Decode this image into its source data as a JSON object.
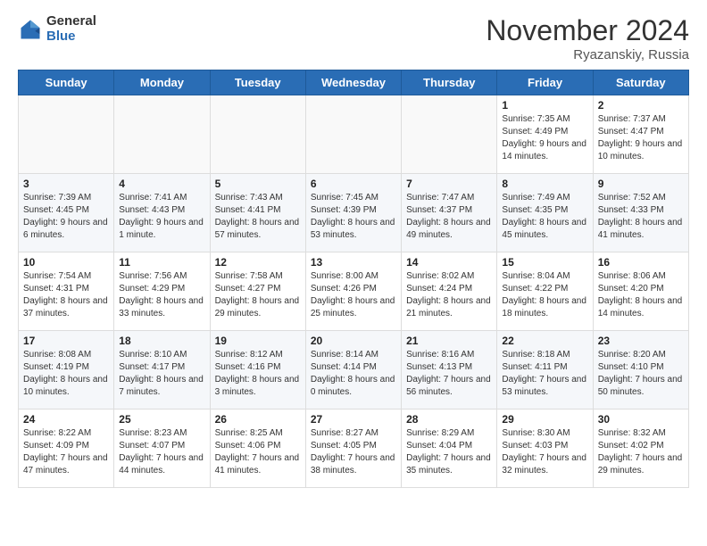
{
  "header": {
    "logo_general": "General",
    "logo_blue": "Blue",
    "month_title": "November 2024",
    "location": "Ryazanskiy, Russia"
  },
  "days_of_week": [
    "Sunday",
    "Monday",
    "Tuesday",
    "Wednesday",
    "Thursday",
    "Friday",
    "Saturday"
  ],
  "weeks": [
    [
      {
        "day": "",
        "info": ""
      },
      {
        "day": "",
        "info": ""
      },
      {
        "day": "",
        "info": ""
      },
      {
        "day": "",
        "info": ""
      },
      {
        "day": "",
        "info": ""
      },
      {
        "day": "1",
        "info": "Sunrise: 7:35 AM\nSunset: 4:49 PM\nDaylight: 9 hours and 14 minutes."
      },
      {
        "day": "2",
        "info": "Sunrise: 7:37 AM\nSunset: 4:47 PM\nDaylight: 9 hours and 10 minutes."
      }
    ],
    [
      {
        "day": "3",
        "info": "Sunrise: 7:39 AM\nSunset: 4:45 PM\nDaylight: 9 hours and 6 minutes."
      },
      {
        "day": "4",
        "info": "Sunrise: 7:41 AM\nSunset: 4:43 PM\nDaylight: 9 hours and 1 minute."
      },
      {
        "day": "5",
        "info": "Sunrise: 7:43 AM\nSunset: 4:41 PM\nDaylight: 8 hours and 57 minutes."
      },
      {
        "day": "6",
        "info": "Sunrise: 7:45 AM\nSunset: 4:39 PM\nDaylight: 8 hours and 53 minutes."
      },
      {
        "day": "7",
        "info": "Sunrise: 7:47 AM\nSunset: 4:37 PM\nDaylight: 8 hours and 49 minutes."
      },
      {
        "day": "8",
        "info": "Sunrise: 7:49 AM\nSunset: 4:35 PM\nDaylight: 8 hours and 45 minutes."
      },
      {
        "day": "9",
        "info": "Sunrise: 7:52 AM\nSunset: 4:33 PM\nDaylight: 8 hours and 41 minutes."
      }
    ],
    [
      {
        "day": "10",
        "info": "Sunrise: 7:54 AM\nSunset: 4:31 PM\nDaylight: 8 hours and 37 minutes."
      },
      {
        "day": "11",
        "info": "Sunrise: 7:56 AM\nSunset: 4:29 PM\nDaylight: 8 hours and 33 minutes."
      },
      {
        "day": "12",
        "info": "Sunrise: 7:58 AM\nSunset: 4:27 PM\nDaylight: 8 hours and 29 minutes."
      },
      {
        "day": "13",
        "info": "Sunrise: 8:00 AM\nSunset: 4:26 PM\nDaylight: 8 hours and 25 minutes."
      },
      {
        "day": "14",
        "info": "Sunrise: 8:02 AM\nSunset: 4:24 PM\nDaylight: 8 hours and 21 minutes."
      },
      {
        "day": "15",
        "info": "Sunrise: 8:04 AM\nSunset: 4:22 PM\nDaylight: 8 hours and 18 minutes."
      },
      {
        "day": "16",
        "info": "Sunrise: 8:06 AM\nSunset: 4:20 PM\nDaylight: 8 hours and 14 minutes."
      }
    ],
    [
      {
        "day": "17",
        "info": "Sunrise: 8:08 AM\nSunset: 4:19 PM\nDaylight: 8 hours and 10 minutes."
      },
      {
        "day": "18",
        "info": "Sunrise: 8:10 AM\nSunset: 4:17 PM\nDaylight: 8 hours and 7 minutes."
      },
      {
        "day": "19",
        "info": "Sunrise: 8:12 AM\nSunset: 4:16 PM\nDaylight: 8 hours and 3 minutes."
      },
      {
        "day": "20",
        "info": "Sunrise: 8:14 AM\nSunset: 4:14 PM\nDaylight: 8 hours and 0 minutes."
      },
      {
        "day": "21",
        "info": "Sunrise: 8:16 AM\nSunset: 4:13 PM\nDaylight: 7 hours and 56 minutes."
      },
      {
        "day": "22",
        "info": "Sunrise: 8:18 AM\nSunset: 4:11 PM\nDaylight: 7 hours and 53 minutes."
      },
      {
        "day": "23",
        "info": "Sunrise: 8:20 AM\nSunset: 4:10 PM\nDaylight: 7 hours and 50 minutes."
      }
    ],
    [
      {
        "day": "24",
        "info": "Sunrise: 8:22 AM\nSunset: 4:09 PM\nDaylight: 7 hours and 47 minutes."
      },
      {
        "day": "25",
        "info": "Sunrise: 8:23 AM\nSunset: 4:07 PM\nDaylight: 7 hours and 44 minutes."
      },
      {
        "day": "26",
        "info": "Sunrise: 8:25 AM\nSunset: 4:06 PM\nDaylight: 7 hours and 41 minutes."
      },
      {
        "day": "27",
        "info": "Sunrise: 8:27 AM\nSunset: 4:05 PM\nDaylight: 7 hours and 38 minutes."
      },
      {
        "day": "28",
        "info": "Sunrise: 8:29 AM\nSunset: 4:04 PM\nDaylight: 7 hours and 35 minutes."
      },
      {
        "day": "29",
        "info": "Sunrise: 8:30 AM\nSunset: 4:03 PM\nDaylight: 7 hours and 32 minutes."
      },
      {
        "day": "30",
        "info": "Sunrise: 8:32 AM\nSunset: 4:02 PM\nDaylight: 7 hours and 29 minutes."
      }
    ]
  ]
}
